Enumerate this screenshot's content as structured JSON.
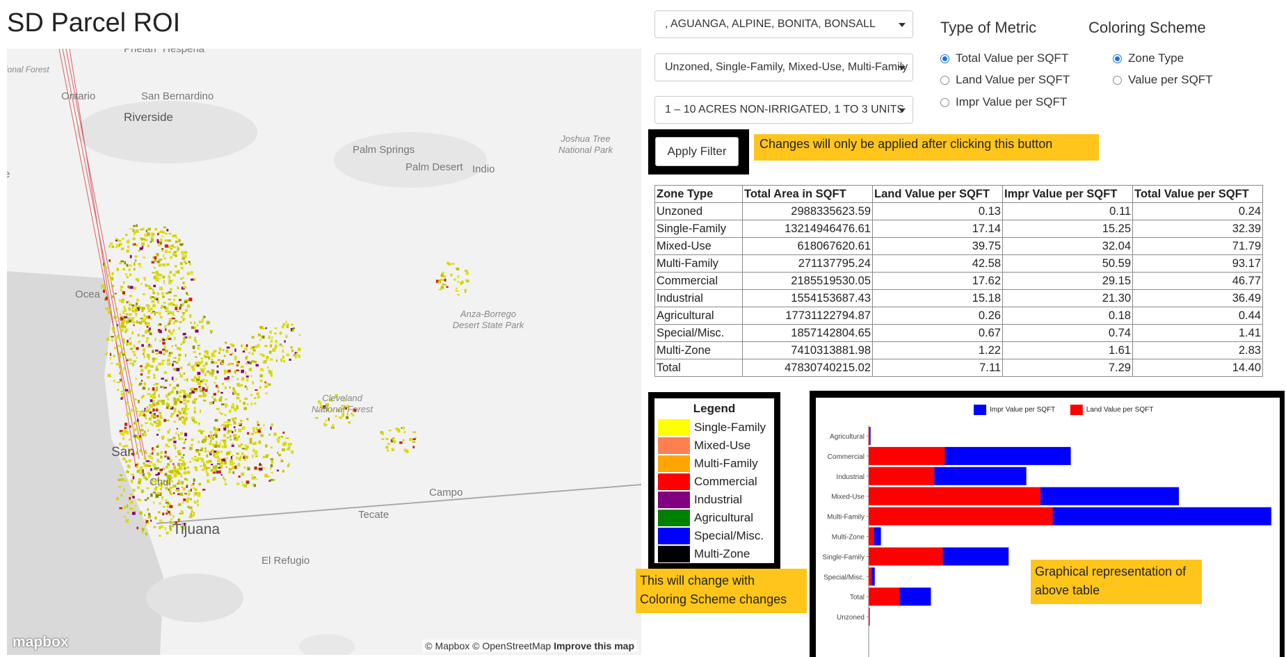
{
  "title": "SD Parcel ROI",
  "filters": {
    "cities": ", AGUANGA, ALPINE, BONITA, BONSALL",
    "zones": "Unzoned, Single-Family, Mixed-Use, Multi-Family",
    "acreage": "1 – 10 ACRES NON-IRRIGATED, 1 TO 3 UNITS"
  },
  "metric": {
    "title": "Type of Metric",
    "options": [
      "Total Value per SQFT",
      "Land Value per SQFT",
      "Impr Value per SQFT"
    ],
    "selected": 0
  },
  "coloring": {
    "title": "Coloring Scheme",
    "options": [
      "Zone Type",
      "Value per SQFT"
    ],
    "selected": 0
  },
  "apply_label": "Apply Filter",
  "notes": {
    "apply": "Changes will only be applied after clicking this button",
    "legend": "This will change with Coloring Scheme changes",
    "chart": "Graphical representation of above table"
  },
  "table": {
    "headers": [
      "Zone Type",
      "Total Area in SQFT",
      "Land Value per SQFT",
      "Impr Value per SQFT",
      "Total Value per SQFT"
    ],
    "rows": [
      [
        "Unzoned",
        "2988335623.59",
        "0.13",
        "0.11",
        "0.24"
      ],
      [
        "Single-Family",
        "13214946476.61",
        "17.14",
        "15.25",
        "32.39"
      ],
      [
        "Mixed-Use",
        "618067620.61",
        "39.75",
        "32.04",
        "71.79"
      ],
      [
        "Multi-Family",
        "271137795.24",
        "42.58",
        "50.59",
        "93.17"
      ],
      [
        "Commercial",
        "2185519530.05",
        "17.62",
        "29.15",
        "46.77"
      ],
      [
        "Industrial",
        "1554153687.43",
        "15.18",
        "21.30",
        "36.49"
      ],
      [
        "Agricultural",
        "17731122794.87",
        "0.26",
        "0.18",
        "0.44"
      ],
      [
        "Special/Misc.",
        "1857142804.65",
        "0.67",
        "0.74",
        "1.41"
      ],
      [
        "Multi-Zone",
        "7410313881.98",
        "1.22",
        "1.61",
        "2.83"
      ],
      [
        "Total",
        "47830740215.02",
        "7.11",
        "7.29",
        "14.40"
      ]
    ]
  },
  "legend": {
    "title": "Legend",
    "items": [
      {
        "label": "Single-Family",
        "color": "#ffff00"
      },
      {
        "label": "Mixed-Use",
        "color": "#ff7f50"
      },
      {
        "label": "Multi-Family",
        "color": "#ffa500"
      },
      {
        "label": "Commercial",
        "color": "#ff0000"
      },
      {
        "label": "Industrial",
        "color": "#800080"
      },
      {
        "label": "Agricultural",
        "color": "#008000"
      },
      {
        "label": "Special/Misc.",
        "color": "#0000ff"
      },
      {
        "label": "Multi-Zone",
        "color": "#000000"
      }
    ]
  },
  "map": {
    "labels": [
      "ional Forest",
      "Ontario",
      "San Bernardino",
      "Riverside",
      "Palm Springs",
      "Palm Desert",
      "Indio",
      "Joshua Tree National Park",
      "Anza-Borrego Desert State Park",
      "Cleveland National Forest",
      "Campo",
      "Tecate",
      "Tijuana",
      "El Refugio",
      "Ocea",
      "Chul",
      "San",
      "Hesperia",
      "Phelan",
      "e"
    ],
    "logo": "mapbox",
    "attribution": "© Mapbox © OpenStreetMap",
    "improve": "Improve this map"
  },
  "chart_data": {
    "type": "bar",
    "orientation": "horizontal",
    "stacked": true,
    "categories": [
      "Agricultural",
      "Commercial",
      "Industrial",
      "Mixed-Use",
      "Multi-Family",
      "Multi-Zone",
      "Single-Family",
      "Special/Misc.",
      "Total",
      "Unzoned"
    ],
    "series": [
      {
        "name": "Land Value per SQFT",
        "color": "#ff0000",
        "values": [
          0.26,
          17.62,
          15.18,
          39.75,
          42.58,
          1.22,
          17.14,
          0.67,
          7.11,
          0.13
        ]
      },
      {
        "name": "Impr Value per SQFT",
        "color": "#0000ff",
        "values": [
          0.18,
          29.15,
          21.3,
          32.04,
          50.59,
          1.61,
          15.25,
          0.74,
          7.29,
          0.11
        ]
      }
    ],
    "legend_order": [
      "Impr Value per SQFT",
      "Land Value per SQFT"
    ],
    "legend_position": "top",
    "xlim": [
      0,
      94
    ]
  }
}
